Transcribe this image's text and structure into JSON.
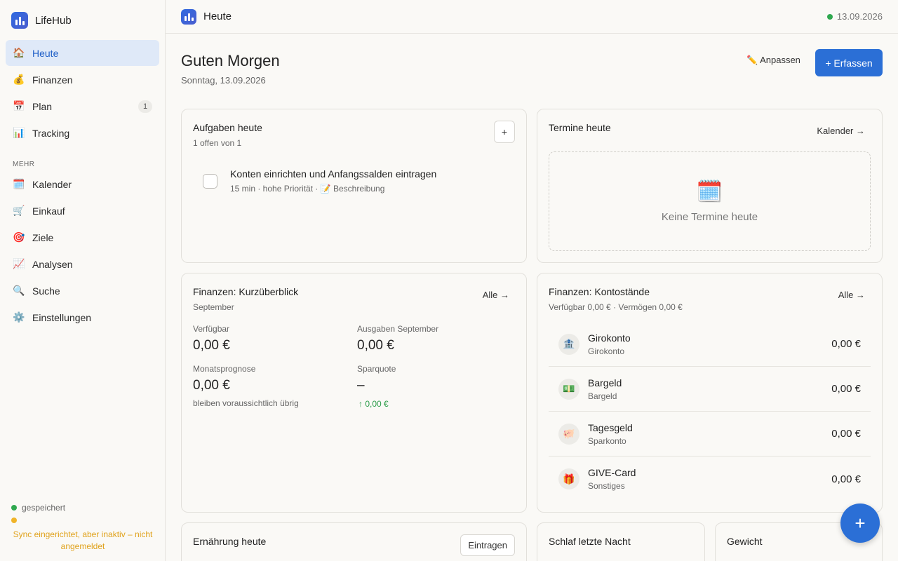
{
  "app": {
    "name": "LifeHub"
  },
  "nav": {
    "items": [
      {
        "icon": "🏠",
        "label": "Heute",
        "active": true
      },
      {
        "icon": "💰",
        "label": "Finanzen"
      },
      {
        "icon": "📅",
        "label": "Plan",
        "badge": "1"
      },
      {
        "icon": "📊",
        "label": "Tracking"
      }
    ],
    "more_section": "MEHR",
    "more_items": [
      {
        "icon": "🗓️",
        "label": "Kalender"
      },
      {
        "icon": "🛒",
        "label": "Einkauf"
      },
      {
        "icon": "🎯",
        "label": "Ziele"
      },
      {
        "icon": "📈",
        "label": "Analysen"
      },
      {
        "icon": "🔍",
        "label": "Suche"
      },
      {
        "icon": "⚙️",
        "label": "Einstellungen"
      }
    ]
  },
  "status": {
    "saved": "gespeichert",
    "sync": "Sync eingerichtet, aber inaktiv – nicht angemeldet"
  },
  "header": {
    "title": "Heute",
    "date": "13.09.2026"
  },
  "page": {
    "greeting": "Guten Morgen",
    "date": "Sonntag, 13.09.2026",
    "adjust_label": "✏️ Anpassen",
    "capture_label": "+ Erfassen"
  },
  "tasks": {
    "title": "Aufgaben heute",
    "subtitle": "1 offen von 1",
    "add_label": "+",
    "items": [
      {
        "title": "Konten einrichten und Anfangssalden eintragen",
        "meta": "15 min · hohe Priorität · 📝 Beschreibung"
      }
    ]
  },
  "appointments": {
    "title": "Termine heute",
    "link": "Kalender →",
    "empty_icon": "🗓️",
    "empty_text": "Keine Termine heute"
  },
  "finance_overview": {
    "title": "Finanzen: Kurzüberblick",
    "subtitle": "September",
    "link": "Alle →",
    "available_label": "Verfügbar",
    "available_value": "0,00 €",
    "expenses_label": "Ausgaben September",
    "expenses_value": "0,00 €",
    "forecast_label": "Monatsprognose",
    "forecast_value": "0,00 €",
    "forecast_note": "bleiben voraussichtlich übrig",
    "savings_label": "Sparquote",
    "savings_value": "–",
    "savings_delta": "↑ 0,00 €"
  },
  "balances": {
    "title": "Finanzen: Kontostände",
    "subtitle": "Verfügbar 0,00 € · Vermögen 0,00 €",
    "link": "Alle →",
    "accounts": [
      {
        "icon": "🏦",
        "name": "Girokonto",
        "type": "Girokonto",
        "amount": "0,00 €"
      },
      {
        "icon": "💵",
        "name": "Bargeld",
        "type": "Bargeld",
        "amount": "0,00 €"
      },
      {
        "icon": "🐖",
        "name": "Tagesgeld",
        "type": "Sparkonto",
        "amount": "0,00 €"
      },
      {
        "icon": "🎁",
        "name": "GIVE-Card",
        "type": "Sonstiges",
        "amount": "0,00 €"
      }
    ]
  },
  "nutrition": {
    "title": "Ernährung heute",
    "button": "Eintragen"
  },
  "sleep": {
    "title": "Schlaf letzte Nacht"
  },
  "weight": {
    "title": "Gewicht"
  },
  "fab": {
    "label": "+"
  },
  "colors": {
    "accent": "#2b6fd6",
    "active_bg": "#dfe9f8",
    "ok": "#2fa84f",
    "warn": "#f0b429"
  }
}
